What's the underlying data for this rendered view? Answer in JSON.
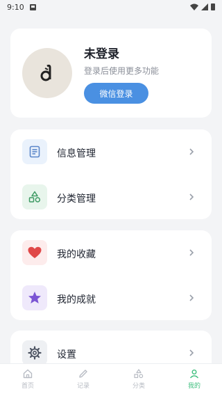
{
  "status_bar": {
    "time": "9:10"
  },
  "profile": {
    "title": "未登录",
    "subtitle": "登录后使用更多功能",
    "login_button": "微信登录"
  },
  "menu_groups": [
    {
      "items": [
        {
          "label": "信息管理",
          "icon": "document-icon",
          "accent": "#5b86c9",
          "bg": "#eaf2fc"
        },
        {
          "label": "分类管理",
          "icon": "shapes-icon",
          "accent": "#3d9a63",
          "bg": "#e8f5ec"
        }
      ]
    },
    {
      "items": [
        {
          "label": "我的收藏",
          "icon": "heart-icon",
          "accent": "#e04848",
          "bg": "#fdecec"
        },
        {
          "label": "我的成就",
          "icon": "star-icon",
          "accent": "#7b55d4",
          "bg": "#efe9fb"
        }
      ]
    },
    {
      "items": [
        {
          "label": "设置",
          "icon": "gear-icon",
          "accent": "#4b5261",
          "bg": "#eef0f3"
        }
      ]
    }
  ],
  "tabbar": {
    "tabs": [
      {
        "label": "首页",
        "icon": "home-icon"
      },
      {
        "label": "记录",
        "icon": "pencil-icon"
      },
      {
        "label": "分类",
        "icon": "shapes-icon"
      },
      {
        "label": "我的",
        "icon": "person-icon"
      }
    ],
    "active_color": "#3fbf7f",
    "inactive_color": "#b7bbc3"
  }
}
